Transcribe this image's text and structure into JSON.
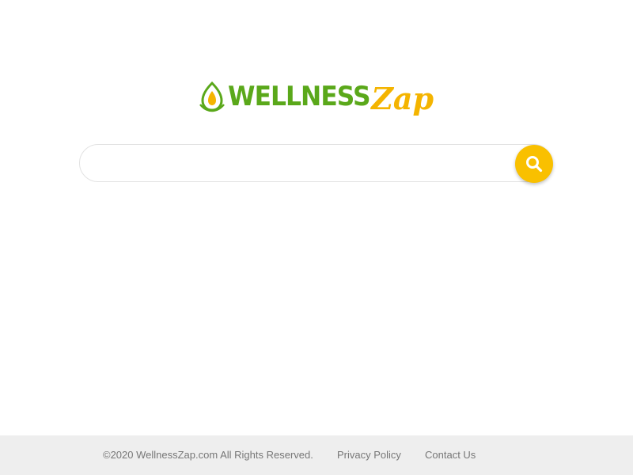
{
  "brand": {
    "logo_part1": "WELLNESS",
    "logo_part2": "Zap",
    "green": "#5aa81a",
    "yellow": "#f4b400"
  },
  "search": {
    "value": "",
    "placeholder": "",
    "button_icon": "search-icon",
    "button_color": "#f9c000"
  },
  "footer": {
    "copyright": "©2020 WellnessZap.com All Rights Reserved.",
    "links": [
      {
        "label": "Privacy Policy"
      },
      {
        "label": "Contact Us"
      }
    ],
    "background": "#eeeeee"
  }
}
